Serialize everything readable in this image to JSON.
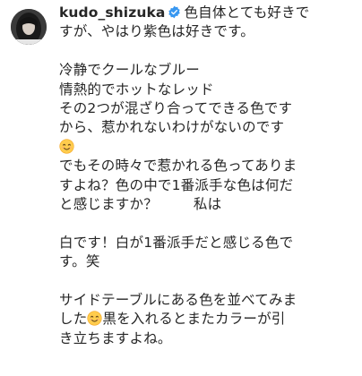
{
  "comment": {
    "username": "kudo_shizuka",
    "verified_icon": "verified-badge-icon",
    "avatar_icon": "profile-avatar",
    "lines": [
      "色自体とても好きで",
      "すが、やはり紫色は好きです。",
      "",
      "冷静でクールなブルー",
      "情熱的でホットなレッド",
      "その2つが混ざり合ってできる色です",
      "から、惹かれないわけがないのです",
      "",
      "でもその時々で惹かれる色ってありま",
      "すよね？色の中で1番派手な色は何だ",
      "と感じますか？",
      "私は",
      "",
      "白です！白が1番派手だと感じる色で",
      "す。笑",
      "",
      "サイドテーブルにある色を並べてみま",
      "した",
      "黒を入れるとまたカラーが引",
      "き立ちますよね。"
    ],
    "emoji_icon": "smiling-face-emoji-icon"
  }
}
